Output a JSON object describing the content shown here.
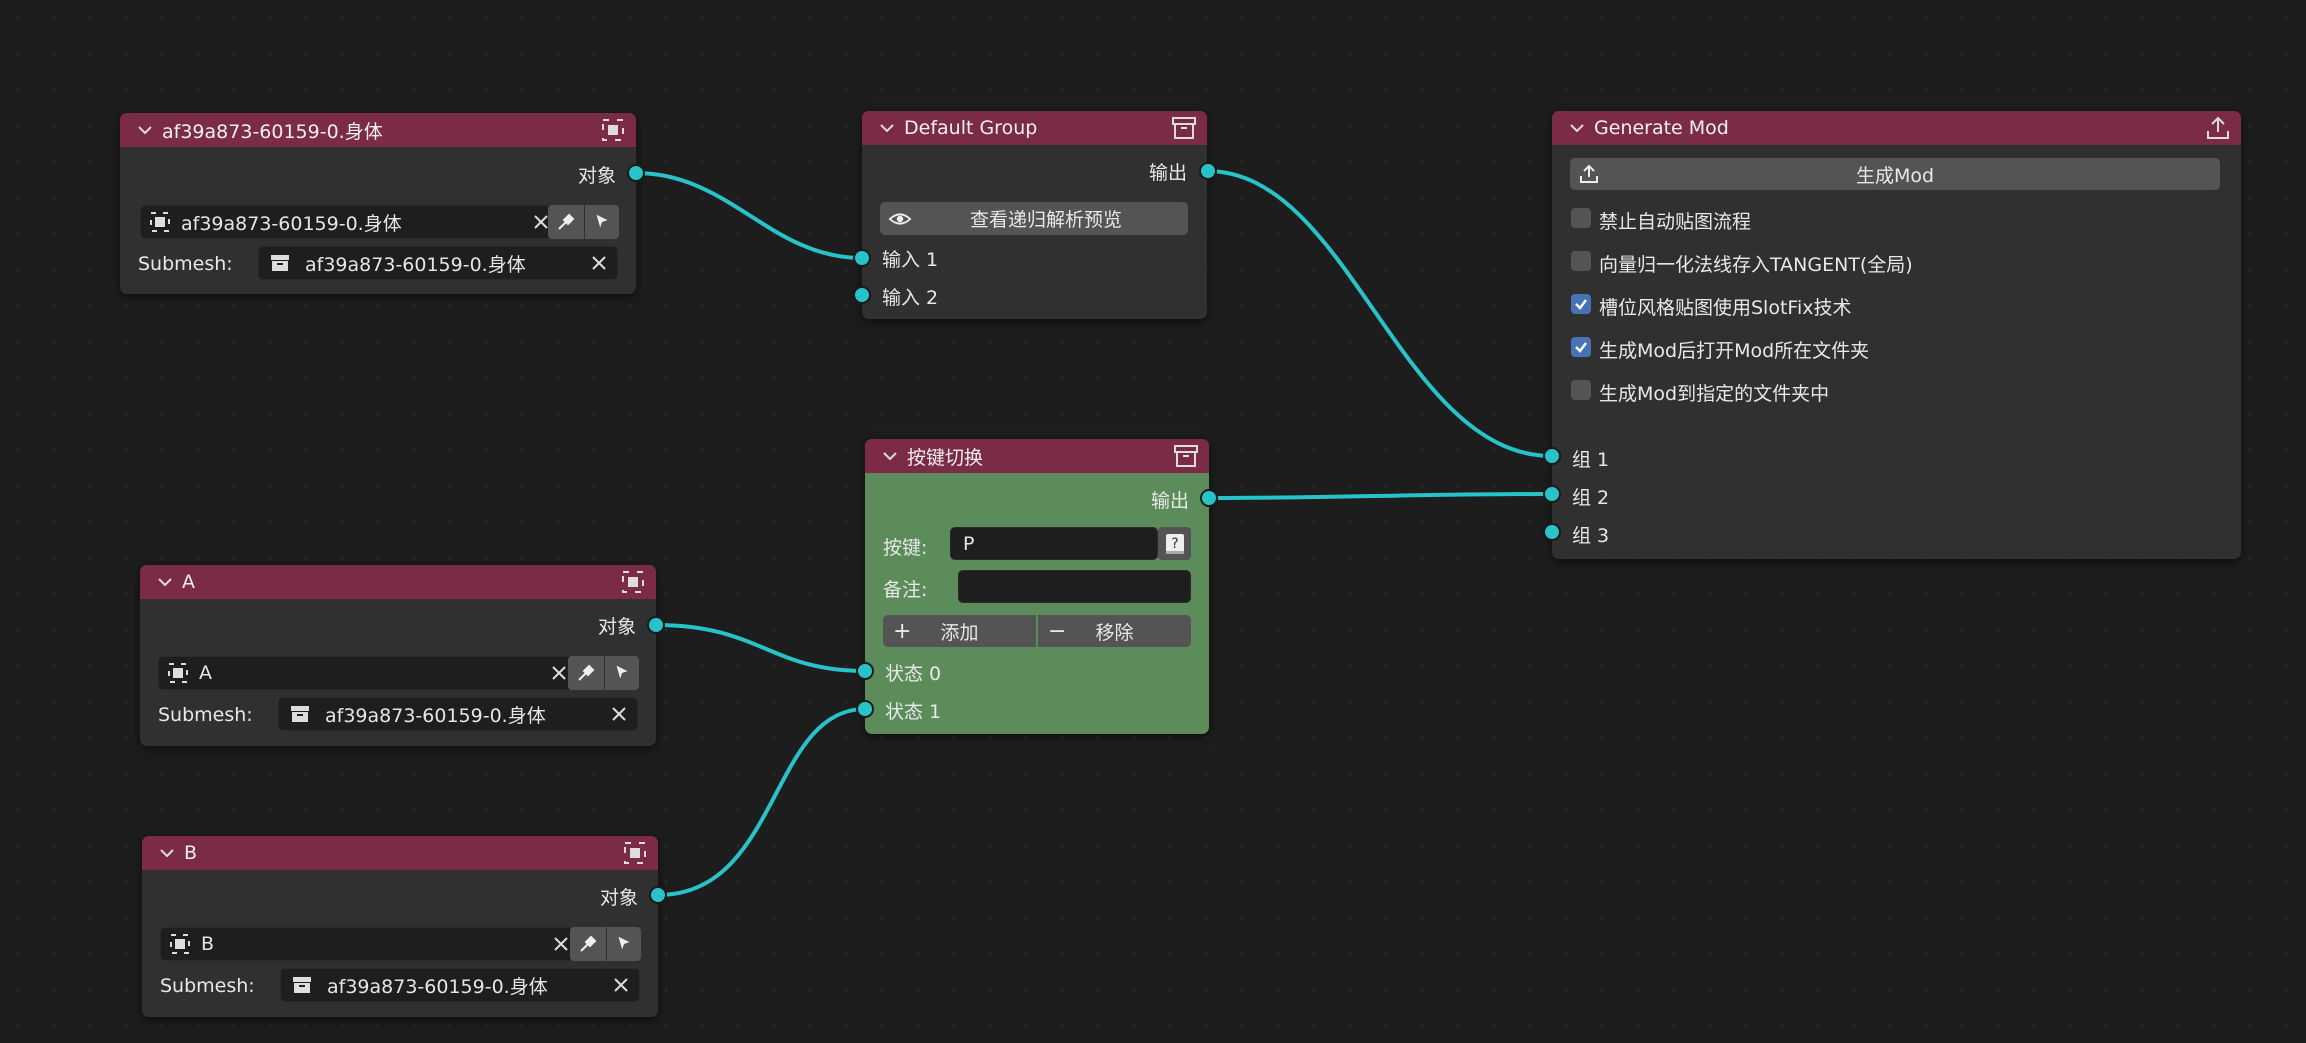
{
  "colors": {
    "wire": "#27c3c9",
    "header": "#7b2b46",
    "node_bg": "#303030",
    "green_node": "#5b8c5a",
    "checkbox_on": "#4772b3"
  },
  "node1": {
    "title": "af39a873-60159-0.身体",
    "output_label": "对象",
    "object_value": "af39a873-60159-0.身体",
    "submesh_label": "Submesh:",
    "submesh_value": "af39a873-60159-0.身体"
  },
  "default_group": {
    "title": "Default Group",
    "output_label": "输出",
    "preview_button": "查看递归解析预览",
    "input1": "输入 1",
    "input2": "输入 2"
  },
  "generate": {
    "title": "Generate Mod",
    "generate_button": "生成Mod",
    "options": [
      {
        "label": "禁止自动贴图流程",
        "checked": false
      },
      {
        "label": "向量归一化法线存入TANGENT(全局)",
        "checked": false
      },
      {
        "label": "槽位风格贴图使用SlotFix技术",
        "checked": true
      },
      {
        "label": "生成Mod后打开Mod所在文件夹",
        "checked": true
      },
      {
        "label": "生成Mod到指定的文件夹中",
        "checked": false
      }
    ],
    "group1": "组 1",
    "group2": "组 2",
    "group3": "组 3"
  },
  "key_switch": {
    "title": "按键切换",
    "output_label": "输出",
    "key_label": "按键:",
    "key_value": "P",
    "note_label": "备注:",
    "note_value": "",
    "add_button": "添加",
    "remove_button": "移除",
    "state0": "状态 0",
    "state1": "状态 1"
  },
  "nodeA": {
    "title": "A",
    "output_label": "对象",
    "object_value": "A",
    "submesh_label": "Submesh:",
    "submesh_value": "af39a873-60159-0.身体"
  },
  "nodeB": {
    "title": "B",
    "output_label": "对象",
    "object_value": "B",
    "submesh_label": "Submesh:",
    "submesh_value": "af39a873-60159-0.身体"
  }
}
